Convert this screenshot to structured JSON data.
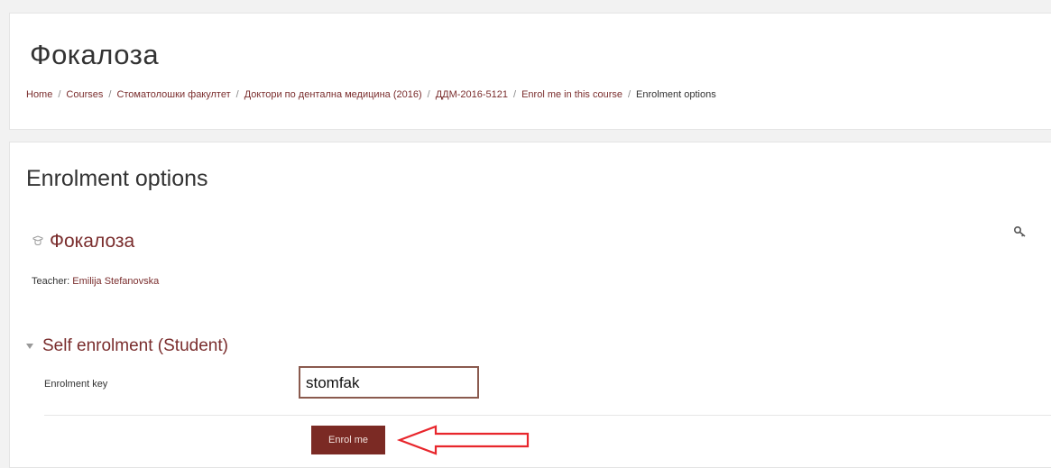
{
  "header": {
    "title": "Фокалоза",
    "breadcrumb": [
      "Home",
      "Courses",
      "Стоматолошки факултет",
      "Доктори по дентална медицина (2016)",
      "ДДМ-2016-5121",
      "Enrol me in this course",
      "Enrolment options"
    ],
    "separator": "/"
  },
  "main": {
    "title": "Enrolment options",
    "course_name": "Фокалоза",
    "teacher_label": "Teacher:",
    "teacher_name": "Emilija Stefanovska",
    "enrolment_method": "Self enrolment (Student)",
    "key_label": "Enrolment key",
    "key_value": "stomfak",
    "enrol_button": "Enrol me"
  },
  "icons": {
    "course": "course-icon",
    "key": "key-icon",
    "collapse": "caret-down-icon",
    "annotation": "red-arrow-icon"
  },
  "colors": {
    "link": "#7a2d2d",
    "button": "#7b2a24",
    "annotation": "#e8262c"
  }
}
